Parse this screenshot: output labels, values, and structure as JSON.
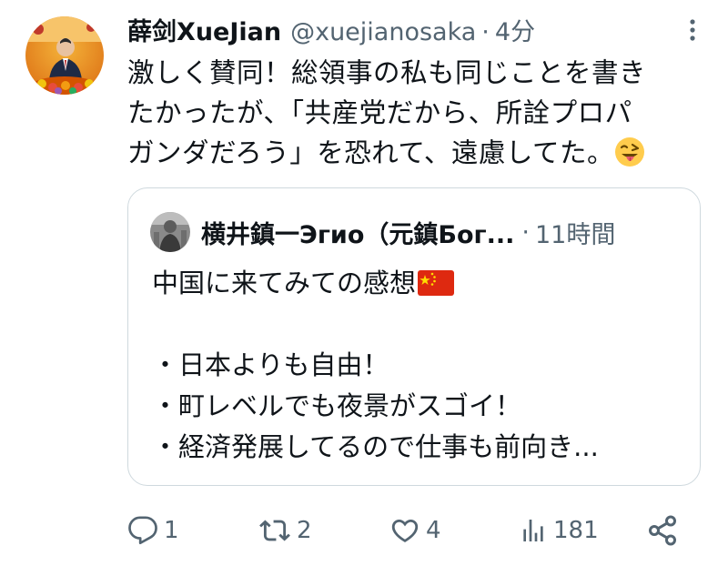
{
  "tweet": {
    "author": {
      "display_name": "薛剑XueJian",
      "handle": "@xuejianosaka",
      "separator": "·",
      "time": "4分"
    },
    "text_lines": [
      "激しく賛同！総領事の私も同じことを書き",
      "たかったが、「共産党だから、所詮プロパ",
      "ガンダだろう」を恐れて、遠慮してた。"
    ],
    "emoji": "winking-face-with-tongue"
  },
  "quote": {
    "author": {
      "display_name": "横井鎮一Эгио（元鎮Бог...",
      "separator": "·",
      "time": "11時間"
    },
    "lines": [
      "中国に来てみての感想",
      "",
      "・日本よりも自由！",
      "・町レベルでも夜景がスゴイ！",
      "・経済発展してるので仕事も前向き..."
    ],
    "flag": "china-flag"
  },
  "actions": {
    "reply_count": "1",
    "retweet_count": "2",
    "like_count": "4",
    "view_count": "181"
  },
  "colors": {
    "text": "#0f1419",
    "muted": "#536471",
    "border": "#cfd9de",
    "emoji_yellow": "#ffcc4d",
    "flag_red": "#de2910",
    "flag_star": "#ffde00"
  }
}
